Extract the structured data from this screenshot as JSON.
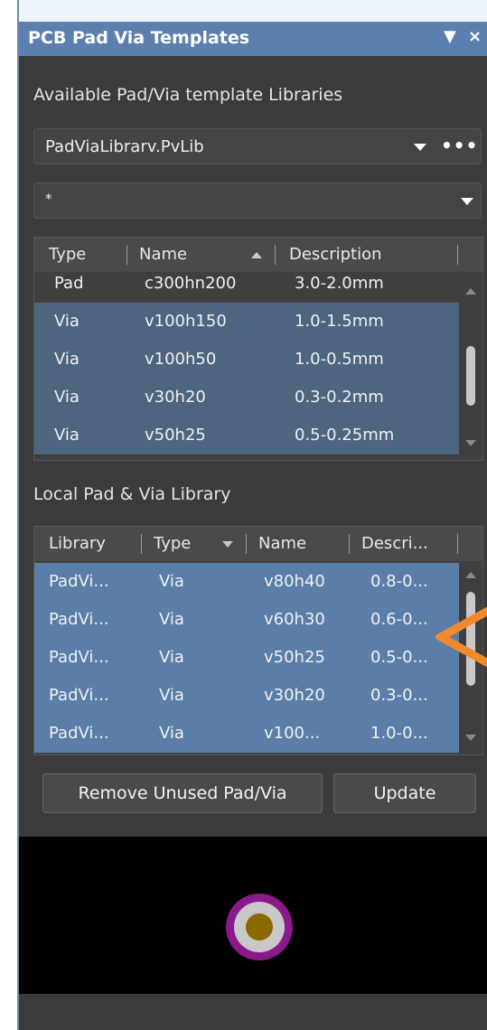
{
  "panel": {
    "title": "PCB Pad Via Templates",
    "menu_glyph": "▼",
    "close_glyph": "×"
  },
  "available": {
    "label": "Available Pad/Via template Libraries",
    "library_select": {
      "value": "PadViaLibrarv.PvLib",
      "more_glyph": "•••"
    },
    "filter_select": {
      "value": "*"
    },
    "columns": [
      "Type",
      "Name",
      "Description"
    ],
    "rows": [
      {
        "type": "Pad",
        "name": "c300hn200",
        "description": "3.0-2.0mm"
      },
      {
        "type": "Via",
        "name": "v100h150",
        "description": "1.0-1.5mm"
      },
      {
        "type": "Via",
        "name": "v100h50",
        "description": "1.0-0.5mm"
      },
      {
        "type": "Via",
        "name": "v30h20",
        "description": "0.3-0.2mm"
      },
      {
        "type": "Via",
        "name": "v50h25",
        "description": "0.5-0.25mm"
      }
    ]
  },
  "local": {
    "label": "Local Pad & Via Library",
    "columns": [
      "Library",
      "Type",
      "Name",
      "Descri..."
    ],
    "rows": [
      {
        "library": "PadVi...",
        "type": "Via",
        "name": "v80h40",
        "description": "0.8-0..."
      },
      {
        "library": "PadVi...",
        "type": "Via",
        "name": "v60h30",
        "description": "0.6-0..."
      },
      {
        "library": "PadVi...",
        "type": "Via",
        "name": "v50h25",
        "description": "0.5-0..."
      },
      {
        "library": "PadVi...",
        "type": "Via",
        "name": "v30h20",
        "description": "0.3-0..."
      },
      {
        "library": "PadVi...",
        "type": "Via",
        "name": "v100...",
        "description": "1.0-0..."
      }
    ]
  },
  "buttons": {
    "remove_unused": "Remove Unused Pad/Via",
    "update": "Update"
  },
  "colors": {
    "title_bar": "#5b80b0",
    "selection": "#5b7ea8",
    "via_ring": "#8a1a8a",
    "via_land": "#c8c8c8",
    "via_hole": "#8a6a00",
    "callout": "#f08a2c"
  }
}
